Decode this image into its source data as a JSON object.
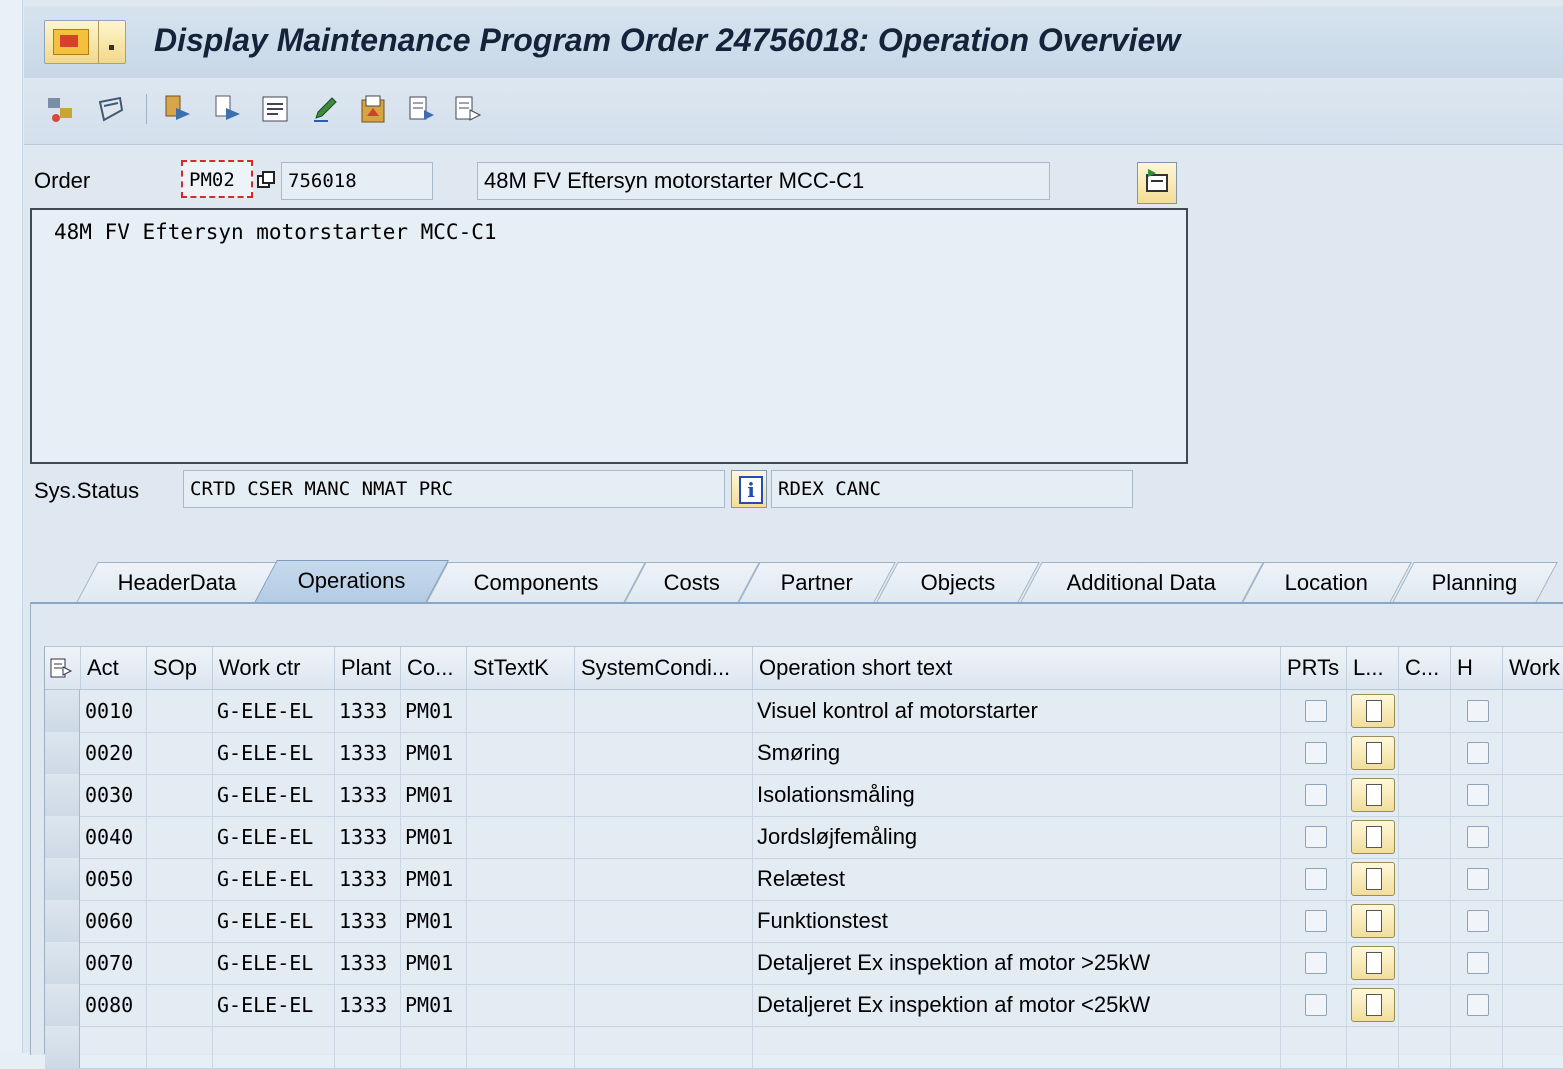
{
  "window": {
    "title": "Display Maintenance Program Order 24756018: Operation Overview"
  },
  "toolbar": {
    "icons": [
      "transfer-icon",
      "eraser-icon",
      "operations-icon",
      "copy-operations-icon",
      "text-icon",
      "edit-pencil-icon",
      "clipboard-icon",
      "export-icon",
      "export2-icon"
    ]
  },
  "header": {
    "order_label": "Order",
    "order_type": "PM02",
    "order_number": "756018",
    "order_description": "48M FV Eftersyn motorstarter MCC-C1",
    "long_text": "48M FV Eftersyn motorstarter MCC-C1",
    "sysstatus_label": "Sys.Status",
    "sysstatus_value": "CRTD CSER MANC NMAT PRC",
    "userstatus_value": "RDEX CANC"
  },
  "tabs": [
    "HeaderData",
    "Operations",
    "Components",
    "Costs",
    "Partner",
    "Objects",
    "Additional Data",
    "Location",
    "Planning"
  ],
  "active_tab": "Operations",
  "table": {
    "columns": [
      "Act",
      "SOp",
      "Work ctr",
      "Plant",
      "Co...",
      "StTextK",
      "SystemCondi...",
      "Operation short text",
      "PRTs",
      "L...",
      "C...",
      "H",
      "Work"
    ],
    "rows": [
      {
        "act": "0010",
        "sop": "",
        "work_ctr": "G-ELE-EL",
        "plant": "1333",
        "co": "PM01",
        "sttextk": "",
        "syscond": "",
        "text": "Visuel kontrol af motorstarter"
      },
      {
        "act": "0020",
        "sop": "",
        "work_ctr": "G-ELE-EL",
        "plant": "1333",
        "co": "PM01",
        "sttextk": "",
        "syscond": "",
        "text": "Smøring"
      },
      {
        "act": "0030",
        "sop": "",
        "work_ctr": "G-ELE-EL",
        "plant": "1333",
        "co": "PM01",
        "sttextk": "",
        "syscond": "",
        "text": "Isolationsmåling"
      },
      {
        "act": "0040",
        "sop": "",
        "work_ctr": "G-ELE-EL",
        "plant": "1333",
        "co": "PM01",
        "sttextk": "",
        "syscond": "",
        "text": "Jordsløjfemåling"
      },
      {
        "act": "0050",
        "sop": "",
        "work_ctr": "G-ELE-EL",
        "plant": "1333",
        "co": "PM01",
        "sttextk": "",
        "syscond": "",
        "text": "Relætest"
      },
      {
        "act": "0060",
        "sop": "",
        "work_ctr": "G-ELE-EL",
        "plant": "1333",
        "co": "PM01",
        "sttextk": "",
        "syscond": "",
        "text": "Funktionstest"
      },
      {
        "act": "0070",
        "sop": "",
        "work_ctr": "G-ELE-EL",
        "plant": "1333",
        "co": "PM01",
        "sttextk": "",
        "syscond": "",
        "text": "Detaljeret Ex inspektion af motor >25kW"
      },
      {
        "act": "0080",
        "sop": "",
        "work_ctr": "G-ELE-EL",
        "plant": "1333",
        "co": "PM01",
        "sttextk": "",
        "syscond": "",
        "text": "Detaljeret Ex inspektion af motor <25kW"
      }
    ]
  },
  "colors": {
    "accent": "#b3cbe4",
    "background": "#dfe8f1",
    "required_marker": "#d12b2b"
  }
}
